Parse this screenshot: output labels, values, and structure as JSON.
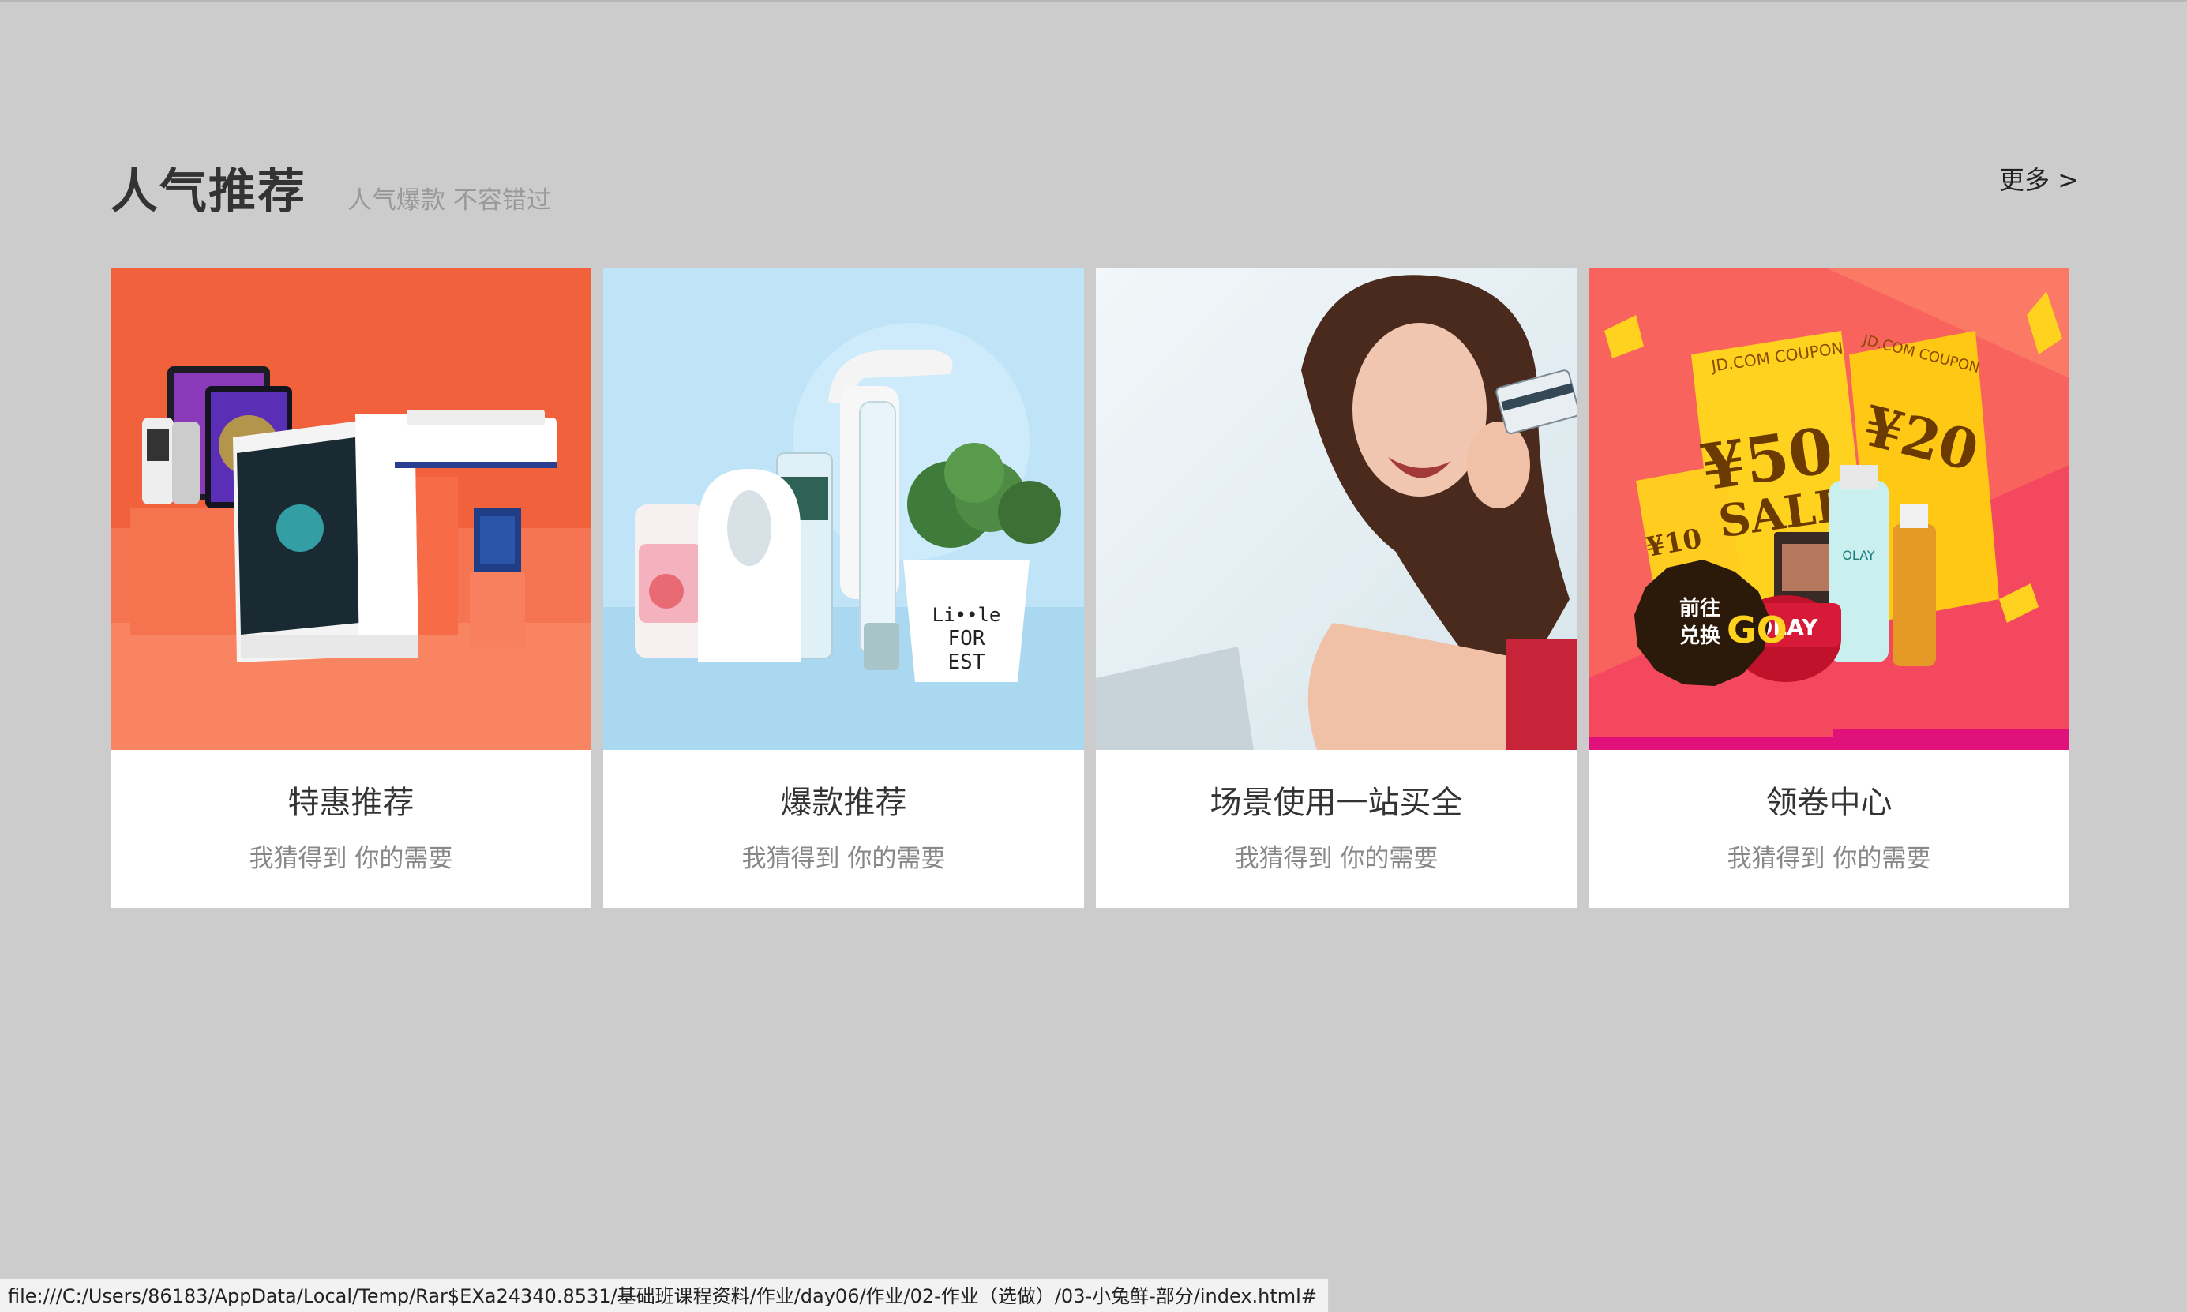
{
  "section": {
    "title": "人气推荐",
    "subtitle": "人气爆款 不容错过",
    "more": "更多 >"
  },
  "cards": [
    {
      "title": "特惠推荐",
      "desc": "我猜得到 你的需要",
      "image": "electronics-products-image"
    },
    {
      "title": "爆款推荐",
      "desc": "我猜得到 你的需要",
      "image": "home-appliances-image",
      "image_text": [
        "Li••le",
        "FOR",
        "EST"
      ]
    },
    {
      "title": "场景使用一站买全",
      "desc": "我猜得到 你的需要",
      "image": "woman-with-credit-card-image"
    },
    {
      "title": "领卷中心",
      "desc": "我猜得到 你的需要",
      "image": "coupon-center-image",
      "image_text": [
        "JD.COM COUPON",
        "¥50",
        "SALE",
        "¥20",
        "¥10",
        "前往",
        "兑换",
        "GO",
        "OLAY"
      ]
    }
  ],
  "status_bar": {
    "url": "file:///C:/Users/86183/AppData/Local/Temp/Rar$EXa24340.8531/基础班课程资料/作业/day06/作业/02-作业（选做）/03-小兔鲜-部分/index.html#"
  },
  "colors": {
    "page_bg": "#cccccc",
    "card_bg": "#ffffff",
    "title": "#333333",
    "subtitle": "#999999",
    "card1_bg": "#f2633f",
    "card2_bg": "#bfe4f7",
    "card4_bg": "#f4485f",
    "coupon_yellow": "#ffd21f"
  }
}
